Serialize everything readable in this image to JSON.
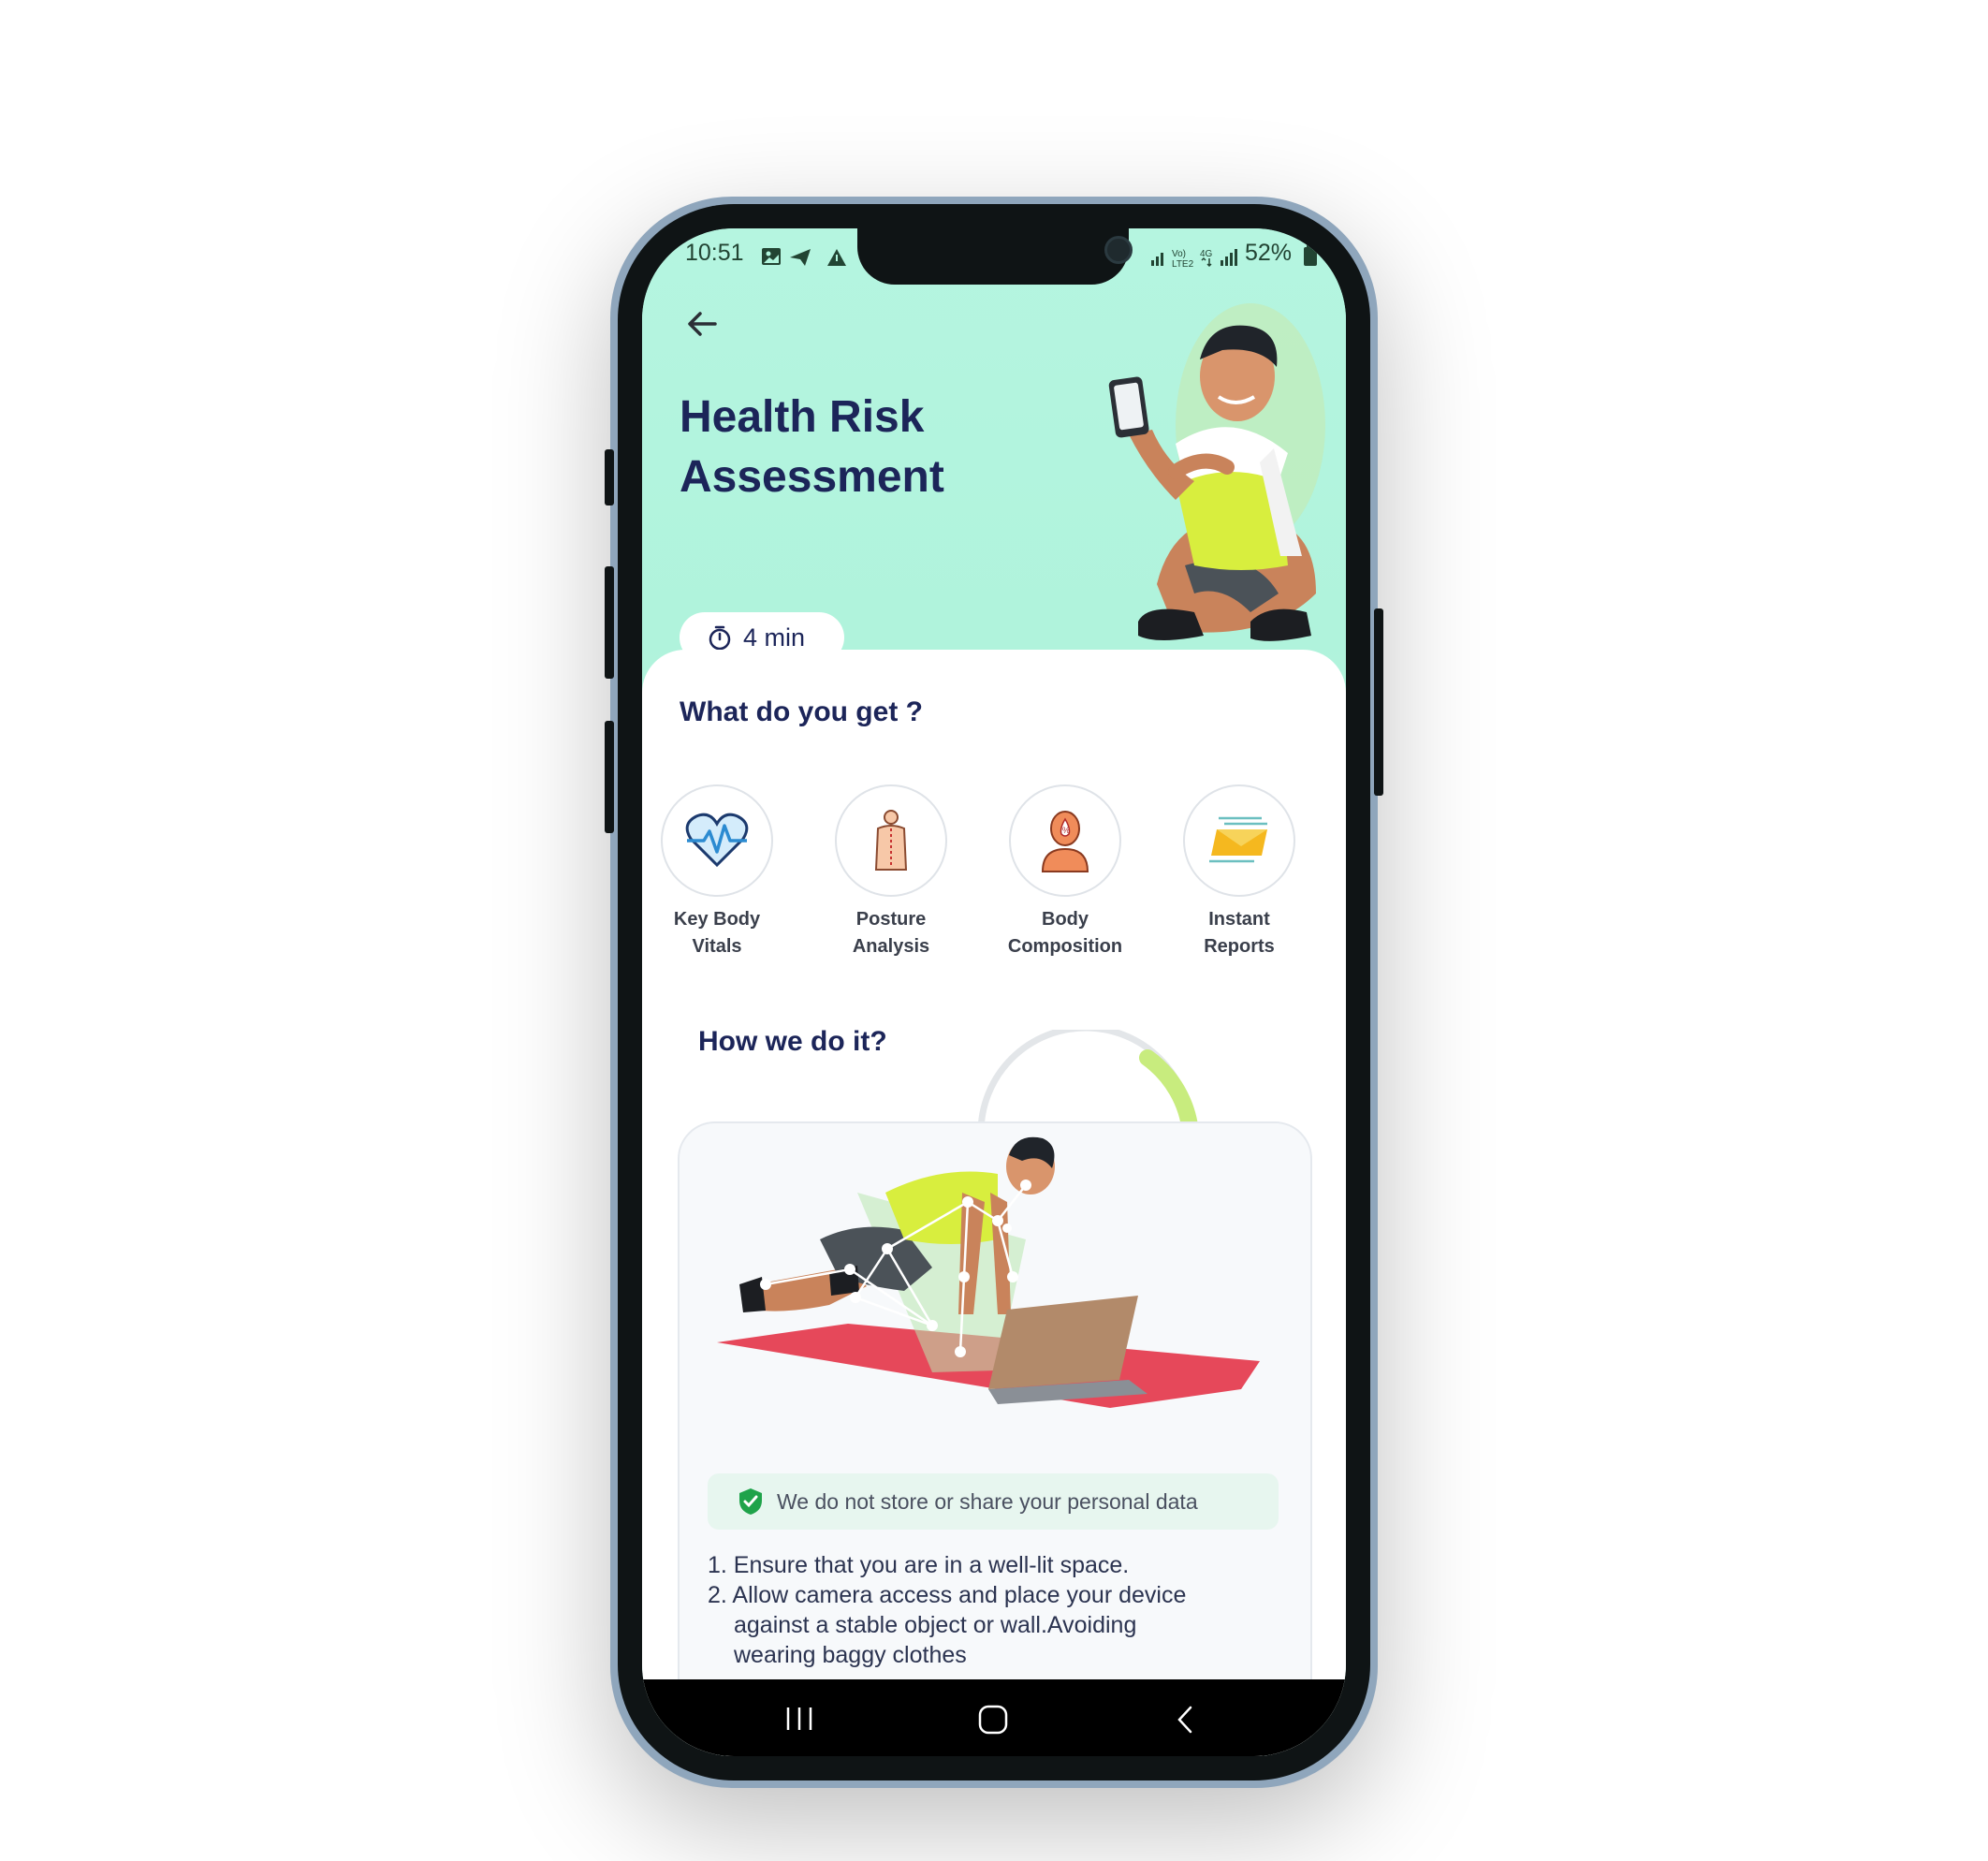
{
  "status_bar": {
    "time": "10:51",
    "network": "Vo) LTE2 4G",
    "battery": "52%"
  },
  "header": {
    "title": "Health Risk Assessment",
    "duration": "4 min"
  },
  "what_section": {
    "title": "What do you get ?",
    "features": [
      {
        "label_line1": "Key Body",
        "label_line2": "Vitals",
        "icon": "heart-pulse-icon"
      },
      {
        "label_line1": "Posture",
        "label_line2": "Analysis",
        "icon": "spine-icon"
      },
      {
        "label_line1": "Body",
        "label_line2": "Composition",
        "icon": "body-composition-icon"
      },
      {
        "label_line1": "Instant",
        "label_line2": "Reports",
        "icon": "report-icon"
      }
    ]
  },
  "how_section": {
    "title": "How we do it?",
    "privacy": "We do not store or share your personal data",
    "steps": [
      "1. Ensure that you are in a well-lit space.",
      "2. Allow camera access and place your device",
      "against a stable object or wall.Avoiding",
      "wearing baggy clothes"
    ]
  },
  "colors": {
    "accent": "#b2f7df",
    "title": "#1c2559",
    "privacy_bg": "#e7f6ef",
    "shield": "#1fa34a"
  }
}
